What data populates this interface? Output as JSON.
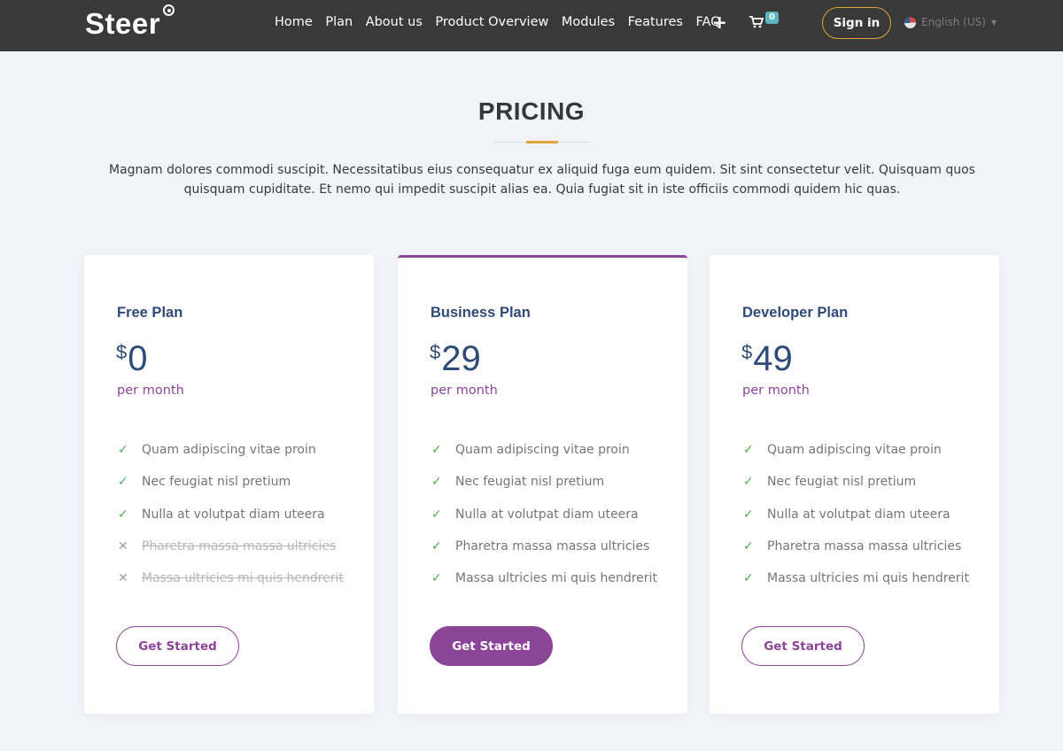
{
  "header": {
    "logo": "Steer",
    "nav": [
      "Home",
      "Plan",
      "About us",
      "Product Overview",
      "Modules",
      "Features",
      "FAQ"
    ],
    "plus_icon": "plus-icon",
    "cart_icon": "cart-icon",
    "cart_count": "0",
    "signin_label": "Sign in",
    "language": "English (US)"
  },
  "section": {
    "title": "PRICING",
    "description": "Magnam dolores commodi suscipit. Necessitatibus eius consequatur ex aliquid fuga eum quidem. Sit sint consectetur velit. Quisquam quos quisquam cupiditate. Et nemo qui impedit suscipit alias ea. Quia fugiat sit in iste officiis commodi quidem hic quas."
  },
  "plans": [
    {
      "name": "Free Plan",
      "currency": "$",
      "price": "0",
      "period": "per month",
      "button": "Get Started",
      "features": [
        {
          "text": "Quam adipiscing vitae proin",
          "included": true
        },
        {
          "text": "Nec feugiat nisl pretium",
          "included": true
        },
        {
          "text": "Nulla at volutpat diam uteera",
          "included": true
        },
        {
          "text": "Pharetra massa massa ultricies",
          "included": false
        },
        {
          "text": "Massa ultricies mi quis hendrerit",
          "included": false
        }
      ]
    },
    {
      "name": "Business Plan",
      "currency": "$",
      "price": "29",
      "period": "per month",
      "button": "Get Started",
      "features": [
        {
          "text": "Quam adipiscing vitae proin",
          "included": true
        },
        {
          "text": "Nec feugiat nisl pretium",
          "included": true
        },
        {
          "text": "Nulla at volutpat diam uteera",
          "included": true
        },
        {
          "text": "Pharetra massa massa ultricies",
          "included": true
        },
        {
          "text": "Massa ultricies mi quis hendrerit",
          "included": true
        }
      ]
    },
    {
      "name": "Developer Plan",
      "currency": "$",
      "price": "49",
      "period": "per month",
      "button": "Get Started",
      "features": [
        {
          "text": "Quam adipiscing vitae proin",
          "included": true
        },
        {
          "text": "Nec feugiat nisl pretium",
          "included": true
        },
        {
          "text": "Nulla at volutpat diam uteera",
          "included": true
        },
        {
          "text": "Pharetra massa massa ultricies",
          "included": true
        },
        {
          "text": "Massa ultricies mi quis hendrerit",
          "included": true
        }
      ]
    }
  ],
  "colors": {
    "accent": "#8b4596",
    "gold": "#e2a33a",
    "navy": "#2e4a76",
    "check": "#4aaf4f",
    "topbar": "#393939"
  }
}
